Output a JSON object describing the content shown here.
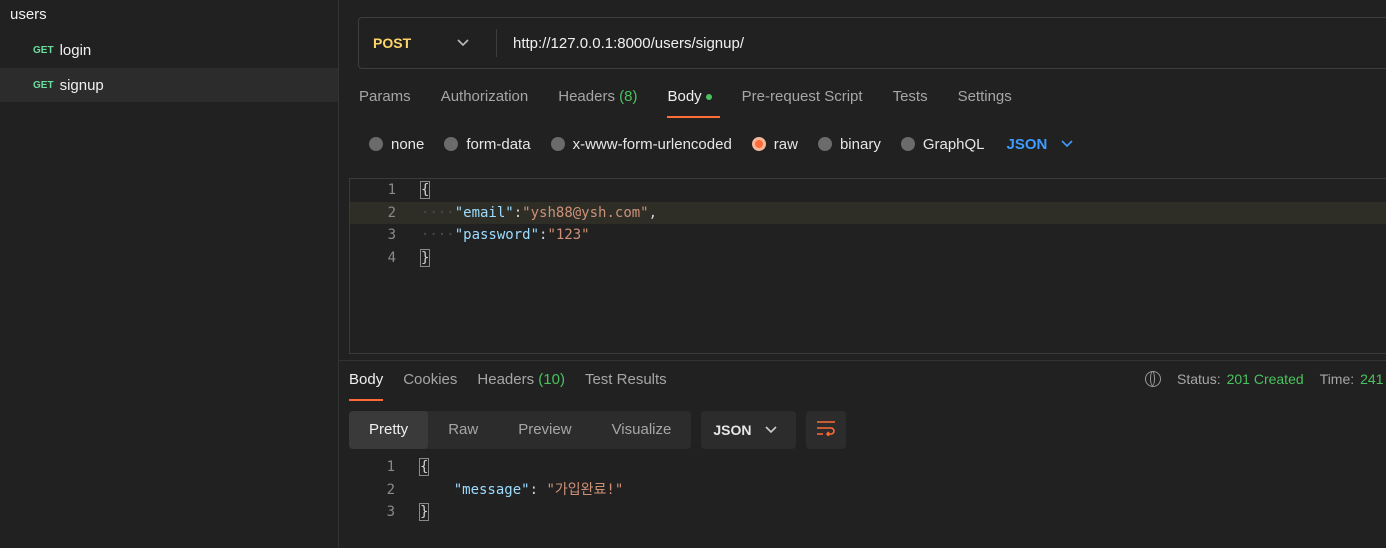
{
  "sidebar": {
    "collection": "users",
    "items": [
      {
        "method": "GET",
        "name": "login"
      },
      {
        "method": "GET",
        "name": "signup"
      }
    ]
  },
  "request": {
    "method": "POST",
    "url": "http://127.0.0.1:8000/users/signup/"
  },
  "tabs": {
    "params": "Params",
    "authorization": "Authorization",
    "headers": "Headers",
    "headers_count": "(8)",
    "body": "Body",
    "prerequest": "Pre-request Script",
    "tests": "Tests",
    "settings": "Settings"
  },
  "body_types": {
    "none": "none",
    "form_data": "form-data",
    "urlencoded": "x-www-form-urlencoded",
    "raw": "raw",
    "binary": "binary",
    "graphql": "GraphQL",
    "format": "JSON",
    "selected": "raw"
  },
  "editor": {
    "lines": [
      "1",
      "2",
      "3",
      "4"
    ],
    "open_brace": "{",
    "close_brace": "}",
    "email_key": "\"email\"",
    "email_value": "\"ysh88@ysh.com\"",
    "password_key": "\"password\"",
    "password_value": "\"123\""
  },
  "response": {
    "tabs": {
      "body": "Body",
      "cookies": "Cookies",
      "headers": "Headers",
      "headers_count": "(10)",
      "test_results": "Test Results"
    },
    "status_label": "Status:",
    "status_value": "201 Created",
    "time_label": "Time:",
    "time_value": "241",
    "view_modes": [
      "Pretty",
      "Raw",
      "Preview",
      "Visualize"
    ],
    "format": "JSON",
    "lines": [
      "1",
      "2",
      "3"
    ],
    "message_key": "\"message\"",
    "message_value": "\"가입완료!\""
  },
  "colors": {
    "accent": "#ff6c37",
    "success": "#49c25d",
    "post": "#ffd46a",
    "link": "#3e9bff"
  }
}
